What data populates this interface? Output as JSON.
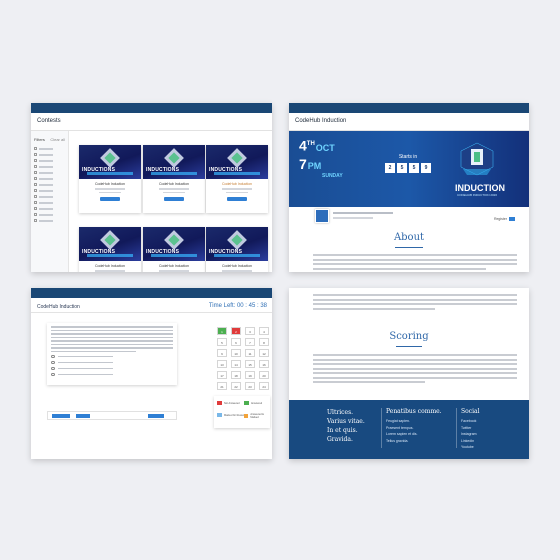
{
  "contests": {
    "title": "Contests",
    "filter_label": "Filters",
    "filter_clear": "Clear all",
    "cards": [
      {
        "thumb_title": "INDUCTIONS",
        "title": "CodeHub Induction"
      },
      {
        "thumb_title": "INDUCTIONS",
        "title": "CodeHub Induction"
      },
      {
        "thumb_title": "INDUCTIONS",
        "title": "CodeHub Induction"
      },
      {
        "thumb_title": "INDUCTIONS",
        "title": "CodeHub Induction"
      },
      {
        "thumb_title": "INDUCTIONS",
        "title": "CodeHub Induction"
      },
      {
        "thumb_title": "INDUCTIONS",
        "title": "CodeHub Induction"
      }
    ]
  },
  "event": {
    "title": "CodeHub Induction",
    "day": "4",
    "day_sup": "TH",
    "month": "OCT",
    "time": "7",
    "time_suffix": "PM",
    "weekday": "SUNDAY",
    "starts_in": "Starts in",
    "countdown": [
      "2",
      "5",
      "5",
      "9"
    ],
    "banner_title": "INDUCTION",
    "banner_sub": "CODEHUB INDUCTION 2020",
    "register": "Register",
    "about_heading": "About"
  },
  "quiz": {
    "title": "CodeHub Induction",
    "timer": "Time Left: 00 : 45 : 38",
    "grid_numbers": [
      "1",
      "2",
      "3",
      "4",
      "5",
      "6",
      "7",
      "8",
      "9",
      "10",
      "11",
      "12",
      "13",
      "14",
      "15",
      "16",
      "17",
      "18",
      "19",
      "20",
      "21",
      "22",
      "23",
      "24"
    ],
    "legend": [
      "Not Answered",
      "Answered",
      "Marked for Review",
      "Answered & Marked"
    ],
    "colors": {
      "answered": "#4caf50",
      "not_answered": "#e03b3b",
      "review": "#7ab8e8",
      "marked": "#f2a33a"
    }
  },
  "scoring": {
    "heading": "Scoring",
    "footer": {
      "col1": [
        "Ultrices.",
        "Varius vitae.",
        "In et quis.",
        "Gravida."
      ],
      "col2_heading": "Penatibus comme.",
      "col2_items": [
        "Feugiat sapien.",
        "Praesent tempus.",
        "Lorem sapien et dis.",
        "Tellus gravida."
      ],
      "col3_heading": "Social",
      "col3_items": [
        "Facebook",
        "Twitter",
        "Instagram",
        "Linkedin",
        "Youtube"
      ]
    }
  }
}
